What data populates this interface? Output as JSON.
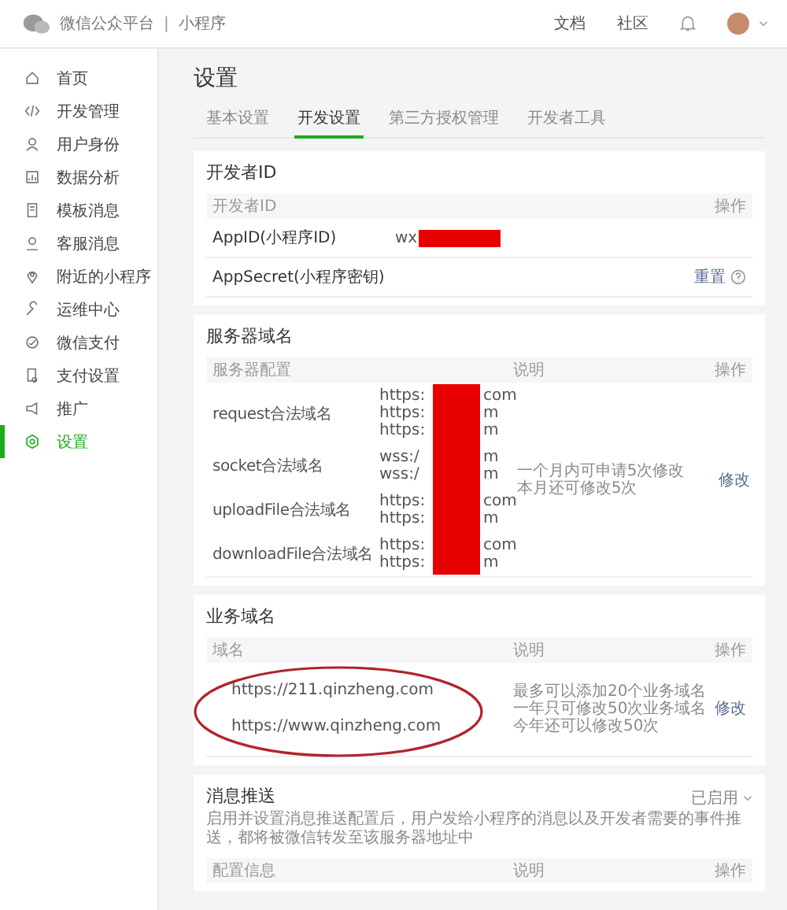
{
  "topbar": {
    "brand": "微信公众平台",
    "separator": "|",
    "product": "小程序",
    "links": [
      "文档",
      "社区"
    ]
  },
  "sidebar": {
    "items": [
      {
        "label": "首页",
        "selected": false
      },
      {
        "label": "开发管理",
        "selected": false
      },
      {
        "label": "用户身份",
        "selected": false
      },
      {
        "label": "数据分析",
        "selected": false
      },
      {
        "label": "模板消息",
        "selected": false
      },
      {
        "label": "客服消息",
        "selected": false
      },
      {
        "label": "附近的小程序",
        "selected": false
      },
      {
        "label": "运维中心",
        "selected": false
      },
      {
        "label": "微信支付",
        "selected": false
      },
      {
        "label": "支付设置",
        "selected": false
      },
      {
        "label": "推广",
        "selected": false
      },
      {
        "label": "设置",
        "selected": true
      }
    ]
  },
  "page_title": "设置",
  "tabs": [
    {
      "label": "基本设置",
      "selected": false
    },
    {
      "label": "开发设置",
      "selected": true
    },
    {
      "label": "第三方授权管理",
      "selected": false
    },
    {
      "label": "开发者工具",
      "selected": false
    }
  ],
  "developer_id": {
    "title": "开发者ID",
    "columns": [
      "开发者ID",
      "操作"
    ],
    "rows": [
      {
        "label": "AppID(小程序ID)",
        "value": "wx",
        "redacted": true
      },
      {
        "label": "AppSecret(小程序密钥)",
        "action": "重置",
        "help": true
      }
    ]
  },
  "server_domains": {
    "title": "服务器域名",
    "columns": [
      "服务器配置",
      "说明",
      "操作"
    ],
    "rows": [
      {
        "name": "request合法域名",
        "urls": [
          {
            "start": "https:",
            "end": "com"
          },
          {
            "start": "https:",
            "end": "m"
          },
          {
            "start": "https:",
            "end": "m"
          }
        ]
      },
      {
        "name": "socket合法域名",
        "urls": [
          {
            "start": "wss:/",
            "end": "m"
          },
          {
            "start": "wss:/",
            "end": "m"
          }
        ]
      },
      {
        "name": "uploadFile合法域名",
        "urls": [
          {
            "start": "https:",
            "end": "com"
          },
          {
            "start": "https:",
            "end": "m"
          }
        ]
      },
      {
        "name": "downloadFile合法域名",
        "urls": [
          {
            "start": "https:",
            "end": "com"
          },
          {
            "start": "https:",
            "end": "m"
          }
        ]
      }
    ],
    "redacted": true,
    "note": [
      "一个月内可申请5次修改",
      "本月还可修改5次"
    ],
    "action": "修改"
  },
  "business_domains": {
    "title": "业务域名",
    "columns": [
      "域名",
      "说明",
      "操作"
    ],
    "domains": [
      "https://211.qinzheng.com",
      "https://www.qinzheng.com"
    ],
    "circled": true,
    "note": [
      "最多可以添加20个业务域名",
      "一年只可修改50次业务域名",
      "今年还可以修改50次"
    ],
    "action": "修改"
  },
  "message_push": {
    "title": "消息推送",
    "status": "已启用",
    "description": "启用并设置消息推送配置后，用户发给小程序的消息以及开发者需要的事件推送，都将被微信转发至该服务器地址中",
    "columns": [
      "配置信息",
      "说明",
      "操作"
    ]
  }
}
